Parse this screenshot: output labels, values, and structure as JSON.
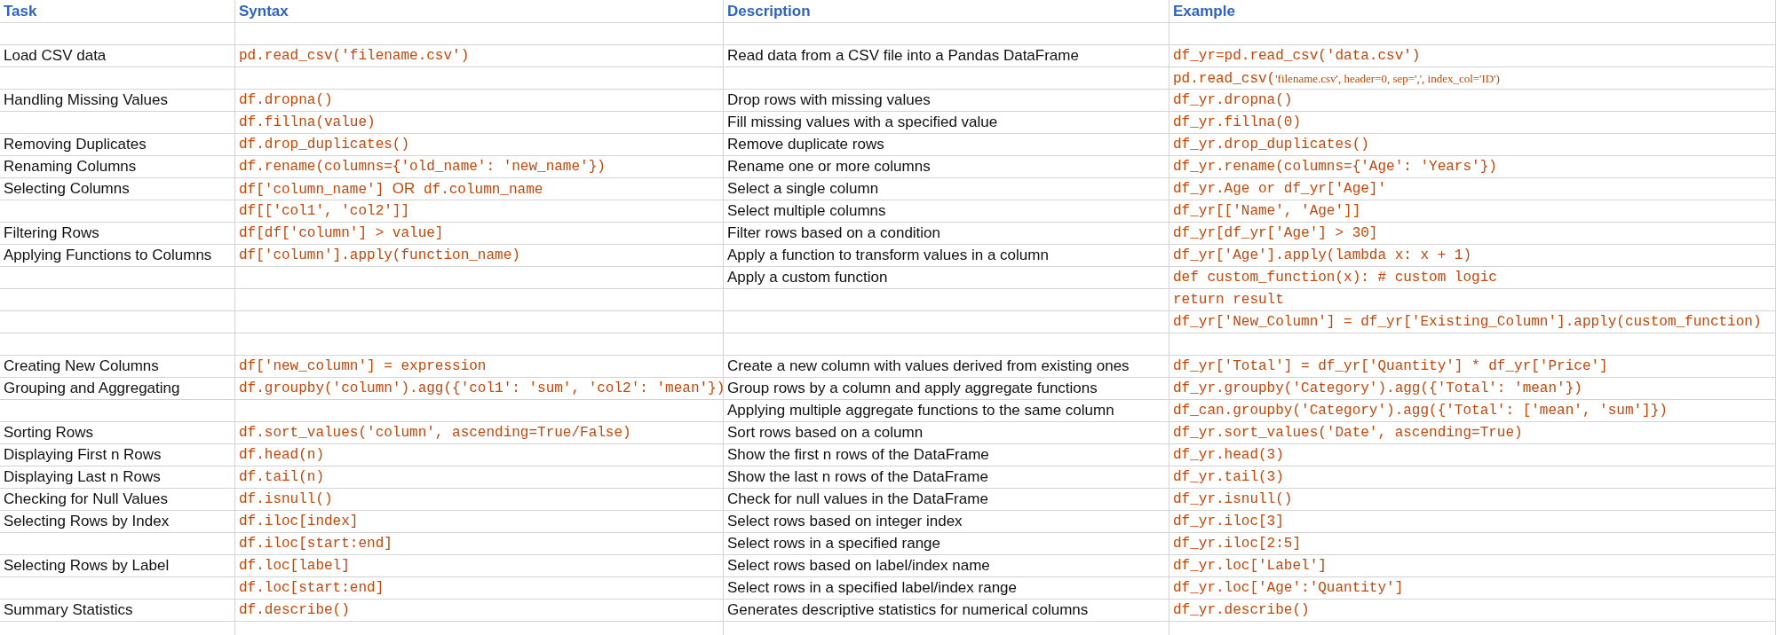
{
  "table": {
    "columns": [
      "Task",
      "Syntax",
      "Description",
      "Example"
    ],
    "rows": [
      {},
      {
        "task": "Load CSV data",
        "syntax": "pd.read_csv('filename.csv')",
        "description": "Read data from a CSV file into a Pandas DataFrame",
        "example": "df_yr=pd.read_csv('data.csv')"
      },
      {
        "example": [
          {
            "kind": "code",
            "text": "pd.read_csv("
          },
          {
            "kind": "serif",
            "text": "'filename.csv', header=0, sep=',', index_col='ID')"
          }
        ]
      },
      {
        "task": "Handling Missing Values",
        "syntax": "df.dropna()",
        "description": "Drop rows with missing values",
        "example": "df_yr.dropna()"
      },
      {
        "syntax": "df.fillna(value)",
        "description": "Fill missing values with a specified value",
        "example": "df_yr.fillna(0)"
      },
      {
        "task": "Removing Duplicates",
        "syntax": "df.drop_duplicates()",
        "description": "Remove duplicate rows",
        "example": "df_yr.drop_duplicates()"
      },
      {
        "task": "Renaming Columns",
        "syntax": "df.rename(columns={'old_name': 'new_name'})",
        "description": "Rename one or more columns",
        "example": "df_yr.rename(columns={'Age': 'Years'})"
      },
      {
        "task": "Selecting Columns",
        "syntax": [
          {
            "kind": "code",
            "text": "df['column_name'] "
          },
          {
            "kind": "sans",
            "text": "OR"
          },
          {
            "kind": "code",
            "text": " df.column_name"
          }
        ],
        "description": "Select a single column",
        "example": "df_yr.Age or df_yr['Age]'"
      },
      {
        "syntax": "df[['col1', 'col2']]",
        "description": "Select multiple columns",
        "example": "df_yr[['Name', 'Age']]"
      },
      {
        "task": "Filtering Rows",
        "syntax": "df[df['column'] > value]",
        "description": "Filter rows based on a condition",
        "example": "df_yr[df_yr['Age'] > 30]"
      },
      {
        "task": "Applying Functions to Columns",
        "syntax": "df['column'].apply(function_name)",
        "description": "Apply a function to transform values in a column",
        "example": "df_yr['Age'].apply(lambda x: x + 1)"
      },
      {
        "description": "Apply a custom function",
        "example": "def custom_function(x): # custom logic"
      },
      {
        "example": "return result"
      },
      {
        "example": "df_yr['New_Column'] = df_yr['Existing_Column'].apply(custom_function)"
      },
      {},
      {
        "task": "Creating New Columns",
        "syntax": "df['new_column'] = expression",
        "description": "Create a new column with values derived from existing ones",
        "example": "df_yr['Total'] = df_yr['Quantity'] * df_yr['Price']"
      },
      {
        "task": "Grouping and Aggregating",
        "syntax": "df.groupby('column').agg({'col1': 'sum', 'col2': 'mean'})",
        "description": "Group rows by a column and apply aggregate functions",
        "example": "df_yr.groupby('Category').agg({'Total': 'mean'})"
      },
      {
        "description": "Applying multiple aggregate functions to the same column",
        "example": "df_can.groupby('Category').agg({'Total': ['mean', 'sum']})"
      },
      {
        "task": "Sorting Rows",
        "syntax": "df.sort_values('column', ascending=True/False)",
        "description": "Sort rows based on a column",
        "example": "df_yr.sort_values('Date', ascending=True)"
      },
      {
        "task": "Displaying First n Rows",
        "syntax": "df.head(n)",
        "description": "Show the first n rows of the DataFrame",
        "example": "df_yr.head(3)"
      },
      {
        "task": "Displaying Last n Rows",
        "syntax": "df.tail(n)",
        "description": "Show the last n rows of the DataFrame",
        "example": "df_yr.tail(3)"
      },
      {
        "task": "Checking for Null Values",
        "syntax": "df.isnull()",
        "description": "Check for null values in the DataFrame",
        "example": "df_yr.isnull()"
      },
      {
        "task": "Selecting Rows by Index",
        "syntax": "df.iloc[index]",
        "description": "Select rows based on integer index",
        "example": "df_yr.iloc[3]"
      },
      {
        "syntax": "df.iloc[start:end]",
        "description": "Select rows in a specified range",
        "example": "df_yr.iloc[2:5]"
      },
      {
        "task": "Selecting Rows by Label",
        "syntax": "df.loc[label]",
        "description": "Select rows based on label/index name",
        "example": "df_yr.loc['Label']"
      },
      {
        "syntax": "df.loc[start:end]",
        "description": "Select rows in a specified label/index range",
        "example": "df_yr.loc['Age':'Quantity']"
      },
      {
        "task": "Summary Statistics",
        "syntax": "df.describe()",
        "description": "Generates descriptive statistics for numerical columns",
        "example": "df_yr.describe()"
      },
      {}
    ]
  }
}
